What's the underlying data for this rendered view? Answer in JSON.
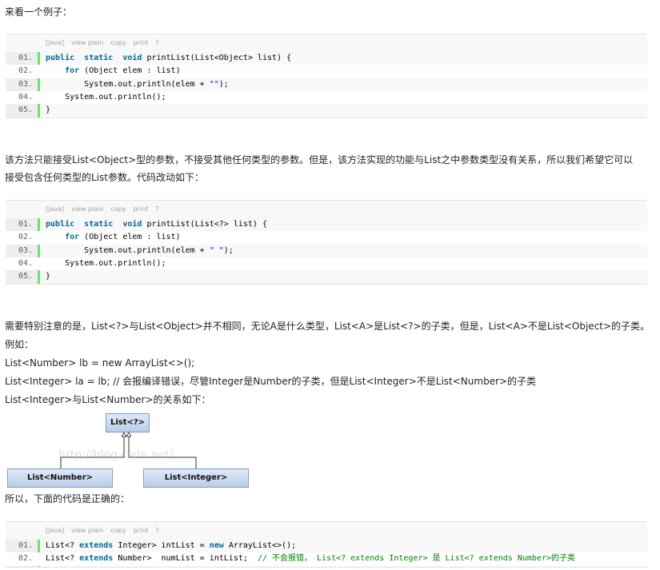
{
  "intro": "来看一个例子：",
  "toolbar": {
    "lang": "[java]",
    "view_plain": "view plain",
    "copy": "copy",
    "print": "print",
    "help": "?"
  },
  "code1": [
    {
      "n": "01.",
      "parts": [
        [
          "kw",
          "public"
        ],
        [
          "",
          "  "
        ],
        [
          "kw",
          "static"
        ],
        [
          "",
          "  "
        ],
        [
          "kw",
          "void"
        ],
        [
          "",
          " printList(List<Object> list) {"
        ]
      ]
    },
    {
      "n": "02.",
      "parts": [
        [
          "",
          "    "
        ],
        [
          "kw",
          "for"
        ],
        [
          "",
          " (Object elem : list)"
        ]
      ]
    },
    {
      "n": "03.",
      "parts": [
        [
          "",
          "        System.out.println(elem + "
        ],
        [
          "str",
          "\"\""
        ],
        [
          "",
          ");"
        ]
      ]
    },
    {
      "n": "04.",
      "parts": [
        [
          "",
          "    System.out.println();"
        ]
      ]
    },
    {
      "n": "05.",
      "parts": [
        [
          "",
          "}"
        ]
      ]
    }
  ],
  "para1_line1": "该方法只能接受List<Object>型的参数，不接受其他任何类型的参数。但是，该方法实现的功能与List之中参数类型没有关系，所以我们希望它可以",
  "para1_line2": "接受包含任何类型的List参数。代码改动如下：",
  "code2": [
    {
      "n": "01.",
      "parts": [
        [
          "kw",
          "public"
        ],
        [
          "",
          "  "
        ],
        [
          "kw",
          "static"
        ],
        [
          "",
          "  "
        ],
        [
          "kw",
          "void"
        ],
        [
          "",
          " printList(List<?> list) {"
        ]
      ]
    },
    {
      "n": "02.",
      "parts": [
        [
          "",
          "    "
        ],
        [
          "kw",
          "for"
        ],
        [
          "",
          " (Object elem : list)"
        ]
      ]
    },
    {
      "n": "03.",
      "parts": [
        [
          "",
          "        System.out.println(elem + "
        ],
        [
          "str",
          "\" \""
        ],
        [
          "",
          ");"
        ]
      ]
    },
    {
      "n": "04.",
      "parts": [
        [
          "",
          "    System.out.println();"
        ]
      ]
    },
    {
      "n": "05.",
      "parts": [
        [
          "",
          "}"
        ]
      ]
    }
  ],
  "para2": "需要特别注意的是，List<?>与List<Object>并不相同，无论A是什么类型，List<A>是List<?>的子类，但是，List<A>不是List<Object>的子类。",
  "para3": "例如：",
  "para4": "List<Number> lb = new ArrayList<>();",
  "para5": "List<Integer> la = lb;   // 会报编译错误，尽管Integer是Number的子类，但是List<Integer>不是List<Number>的子类",
  "para6": "List<Integer>与List<Number>的关系如下：",
  "diagram": {
    "top": "List<?>",
    "left": "List<Number>",
    "right": "List<Integer>",
    "watermark": "http://blog.csdn.net/"
  },
  "para7": "所以，下面的代码是正确的：",
  "code3": [
    {
      "n": "01.",
      "parts": [
        [
          "",
          "List<? "
        ],
        [
          "kw",
          "extends"
        ],
        [
          "",
          " Integer> intList = "
        ],
        [
          "kw",
          "new"
        ],
        [
          "",
          " ArrayList<>();"
        ]
      ]
    },
    {
      "n": "02.",
      "parts": [
        [
          "",
          "List<? "
        ],
        [
          "kw",
          "extends"
        ],
        [
          "",
          " Number>  numList = intList;  "
        ],
        [
          "cmt",
          "// 不会报错， List<? extends Integer> 是 List<? extends Number>的子类"
        ]
      ]
    }
  ]
}
